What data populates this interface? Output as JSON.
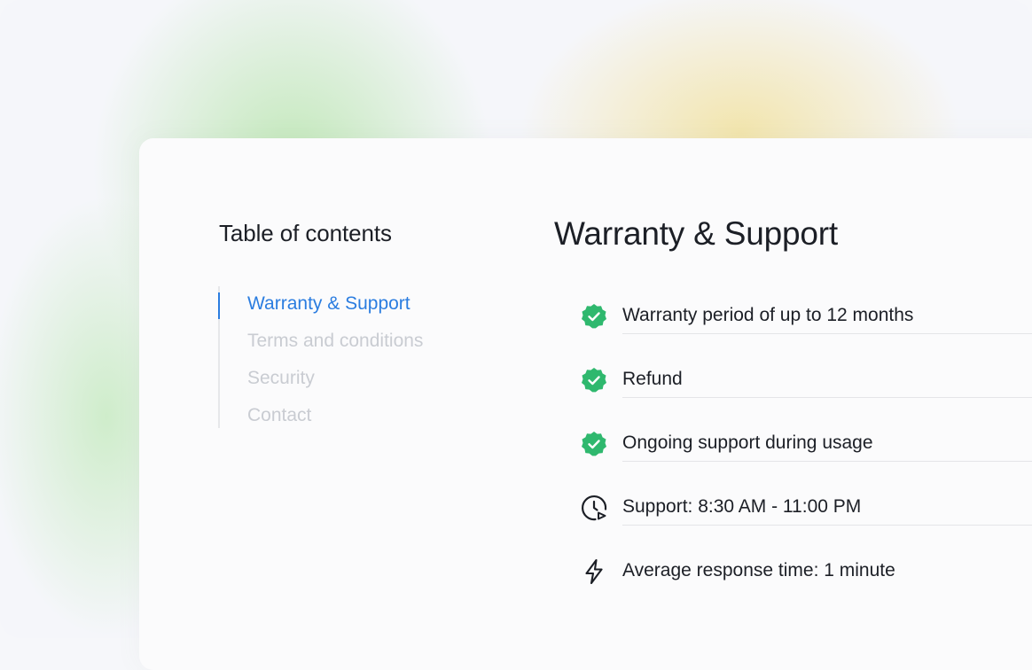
{
  "toc": {
    "title": "Table of contents",
    "items": [
      {
        "label": "Warranty & Support",
        "active": true
      },
      {
        "label": "Terms and conditions",
        "active": false
      },
      {
        "label": "Security",
        "active": false
      },
      {
        "label": "Contact",
        "active": false
      }
    ]
  },
  "section": {
    "title": "Warranty & Support",
    "features": [
      {
        "icon": "verified-check-icon",
        "label": "Warranty period of up to 12 months"
      },
      {
        "icon": "verified-check-icon",
        "label": "Refund"
      },
      {
        "icon": "verified-check-icon",
        "label": "Ongoing support during usage"
      },
      {
        "icon": "clock-icon",
        "label": "Support: 8:30 AM - 11:00 PM"
      },
      {
        "icon": "lightning-icon",
        "label": "Average response time: 1 minute"
      }
    ]
  },
  "colors": {
    "accent": "#2b7de0",
    "check_green": "#2fb86e",
    "text": "#1c1f26",
    "muted": "#c9ccd2"
  }
}
